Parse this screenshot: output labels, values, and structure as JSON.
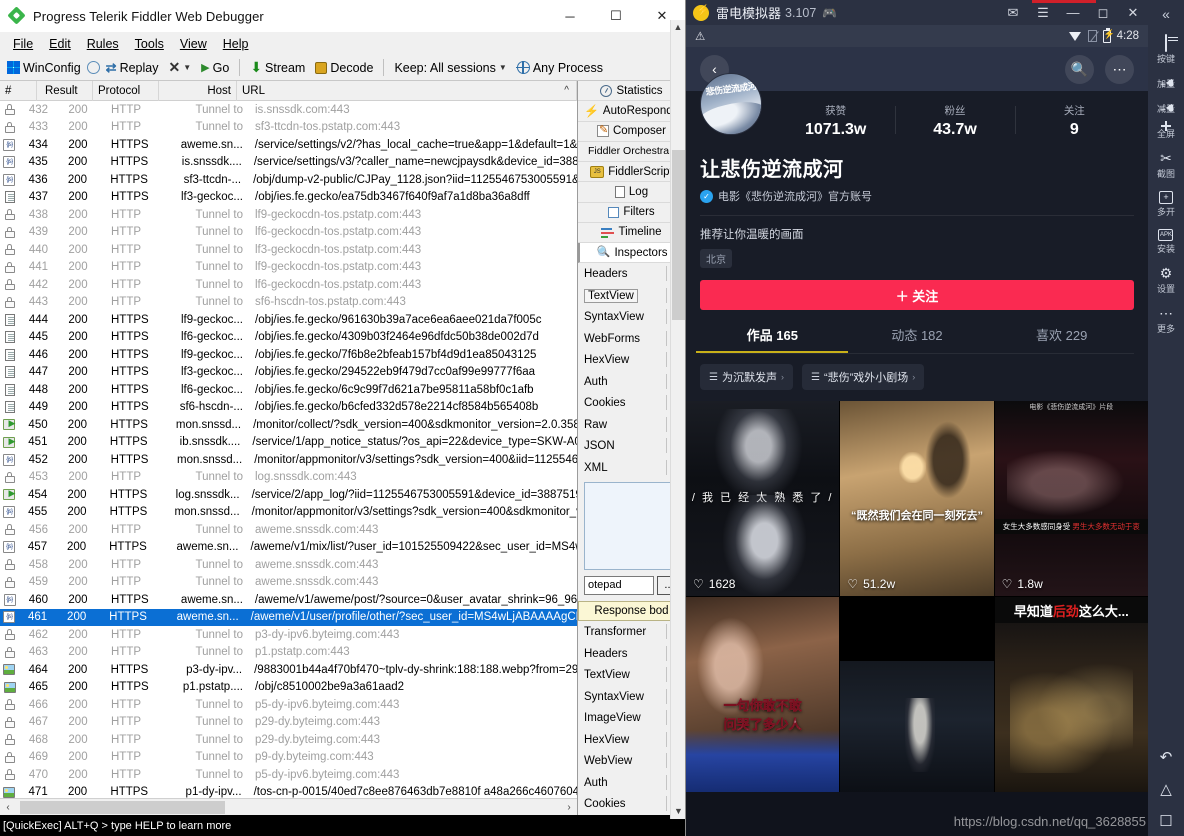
{
  "fiddler": {
    "title": "Progress Telerik Fiddler Web Debugger",
    "window_buttons": {
      "minimize": "─",
      "maximize": "☐",
      "close": "✕"
    },
    "menu": [
      "File",
      "Edit",
      "Rules",
      "Tools",
      "View",
      "Help"
    ],
    "toolbar": {
      "winconfig": "WinConfig",
      "replay": "Replay",
      "remove": "✕",
      "go": "Go",
      "stream": "Stream",
      "decode": "Decode",
      "keep": "Keep: All sessions",
      "process": "Any Process"
    },
    "columns": [
      "#",
      "Result",
      "Protocol",
      "Host",
      "URL"
    ],
    "sessions": [
      {
        "icon": "lock-icon",
        "num": "432",
        "result": "200",
        "protocol": "HTTP",
        "host": "Tunnel to",
        "url": "is.snssdk.com:443",
        "dim": true
      },
      {
        "icon": "lock-icon",
        "num": "433",
        "result": "200",
        "protocol": "HTTP",
        "host": "Tunnel to",
        "url": "sf3-ttcdn-tos.pstatp.com:443",
        "dim": true
      },
      {
        "icon": "json-icon",
        "num": "434",
        "result": "200",
        "protocol": "HTTPS",
        "host": "aweme.sn...",
        "url": "/service/settings/v2/?has_local_cache=true&app=1&default=1&",
        "dim": false
      },
      {
        "icon": "json-icon",
        "num": "435",
        "result": "200",
        "protocol": "HTTPS",
        "host": "is.snssdk....",
        "url": "/service/settings/v3/?caller_name=newcjpaysdk&device_id=388",
        "dim": false
      },
      {
        "icon": "json-icon",
        "num": "436",
        "result": "200",
        "protocol": "HTTPS",
        "host": "sf3-ttcdn-...",
        "url": "/obj/dump-v2-public/CJPay_1128.json?iid=1125546753005591&",
        "dim": false
      },
      {
        "icon": "doc-icon",
        "num": "437",
        "result": "200",
        "protocol": "HTTPS",
        "host": "lf3-geckoc...",
        "url": "/obj/ies.fe.gecko/ea75db3467f640f9af7a1d8ba36a8dff",
        "dim": false
      },
      {
        "icon": "lock-icon",
        "num": "438",
        "result": "200",
        "protocol": "HTTP",
        "host": "Tunnel to",
        "url": "lf9-geckocdn-tos.pstatp.com:443",
        "dim": true
      },
      {
        "icon": "lock-icon",
        "num": "439",
        "result": "200",
        "protocol": "HTTP",
        "host": "Tunnel to",
        "url": "lf6-geckocdn-tos.pstatp.com:443",
        "dim": true
      },
      {
        "icon": "lock-icon",
        "num": "440",
        "result": "200",
        "protocol": "HTTP",
        "host": "Tunnel to",
        "url": "lf3-geckocdn-tos.pstatp.com:443",
        "dim": true
      },
      {
        "icon": "lock-icon",
        "num": "441",
        "result": "200",
        "protocol": "HTTP",
        "host": "Tunnel to",
        "url": "lf9-geckocdn-tos.pstatp.com:443",
        "dim": true
      },
      {
        "icon": "lock-icon",
        "num": "442",
        "result": "200",
        "protocol": "HTTP",
        "host": "Tunnel to",
        "url": "lf6-geckocdn-tos.pstatp.com:443",
        "dim": true
      },
      {
        "icon": "lock-icon",
        "num": "443",
        "result": "200",
        "protocol": "HTTP",
        "host": "Tunnel to",
        "url": "sf6-hscdn-tos.pstatp.com:443",
        "dim": true
      },
      {
        "icon": "doc-icon",
        "num": "444",
        "result": "200",
        "protocol": "HTTPS",
        "host": "lf9-geckoc...",
        "url": "/obj/ies.fe.gecko/961630b39a7ace6ea6aee021da7f005c",
        "dim": false
      },
      {
        "icon": "doc-icon",
        "num": "445",
        "result": "200",
        "protocol": "HTTPS",
        "host": "lf6-geckoc...",
        "url": "/obj/ies.fe.gecko/4309b03f2464e96dfdc50b38de002d7d",
        "dim": false
      },
      {
        "icon": "doc-icon",
        "num": "446",
        "result": "200",
        "protocol": "HTTPS",
        "host": "lf9-geckoc...",
        "url": "/obj/ies.fe.gecko/7f6b8e2bfeab157bf4d9d1ea85043125",
        "dim": false
      },
      {
        "icon": "doc-icon",
        "num": "447",
        "result": "200",
        "protocol": "HTTPS",
        "host": "lf3-geckoc...",
        "url": "/obj/ies.fe.gecko/294522eb9f479d7cc0af99e99777f6aa",
        "dim": false
      },
      {
        "icon": "doc-icon",
        "num": "448",
        "result": "200",
        "protocol": "HTTPS",
        "host": "lf6-geckoc...",
        "url": "/obj/ies.fe.gecko/6c9c99f7d621a7be95811a58bf0c1afb",
        "dim": false
      },
      {
        "icon": "doc-icon",
        "num": "449",
        "result": "200",
        "protocol": "HTTPS",
        "host": "sf6-hscdn-...",
        "url": "/obj/ies.fe.gecko/b6cfed332d578e2214cf8584b565408b",
        "dim": false
      },
      {
        "icon": "arrow-icon",
        "num": "450",
        "result": "200",
        "protocol": "HTTPS",
        "host": "mon.snssd...",
        "url": "/monitor/collect/?sdk_version=400&sdkmonitor_version=2.0.358",
        "dim": false
      },
      {
        "icon": "arrow-icon",
        "num": "451",
        "result": "200",
        "protocol": "HTTPS",
        "host": "ib.snssdk....",
        "url": "/service/1/app_notice_status/?os_api=22&device_type=SKW-A0",
        "dim": false
      },
      {
        "icon": "json-icon",
        "num": "452",
        "result": "200",
        "protocol": "HTTPS",
        "host": "mon.snssd...",
        "url": "/monitor/appmonitor/v3/settings?sdk_version=400&iid=1125546",
        "dim": false
      },
      {
        "icon": "lock-icon",
        "num": "453",
        "result": "200",
        "protocol": "HTTP",
        "host": "Tunnel to",
        "url": "log.snssdk.com:443",
        "dim": true
      },
      {
        "icon": "arrow-icon",
        "num": "454",
        "result": "200",
        "protocol": "HTTPS",
        "host": "log.snssdk...",
        "url": "/service/2/app_log/?iid=1125546753005591&device_id=3887519",
        "dim": false
      },
      {
        "icon": "json-icon",
        "num": "455",
        "result": "200",
        "protocol": "HTTPS",
        "host": "mon.snssd...",
        "url": "/monitor/appmonitor/v3/settings?sdk_version=400&sdkmonitor_v",
        "dim": false
      },
      {
        "icon": "lock-icon",
        "num": "456",
        "result": "200",
        "protocol": "HTTP",
        "host": "Tunnel to",
        "url": "aweme.snssdk.com:443",
        "dim": true
      },
      {
        "icon": "json-icon",
        "num": "457",
        "result": "200",
        "protocol": "HTTPS",
        "host": "aweme.sn...",
        "url": "/aweme/v1/mix/list/?user_id=101525509422&sec_user_id=MS4w",
        "dim": false
      },
      {
        "icon": "lock-icon",
        "num": "458",
        "result": "200",
        "protocol": "HTTP",
        "host": "Tunnel to",
        "url": "aweme.snssdk.com:443",
        "dim": true
      },
      {
        "icon": "lock-icon",
        "num": "459",
        "result": "200",
        "protocol": "HTTP",
        "host": "Tunnel to",
        "url": "aweme.snssdk.com:443",
        "dim": true
      },
      {
        "icon": "json-icon",
        "num": "460",
        "result": "200",
        "protocol": "HTTPS",
        "host": "aweme.sn...",
        "url": "/aweme/v1/aweme/post/?source=0&user_avatar_shrink=96_96",
        "dim": false
      },
      {
        "icon": "json-icon",
        "num": "461",
        "result": "200",
        "protocol": "HTTPS",
        "host": "aweme.sn...",
        "url": "/aweme/v1/user/profile/other/?sec_user_id=MS4wLjABAAAAgCE",
        "dim": false,
        "selected": true
      },
      {
        "icon": "lock-icon",
        "num": "462",
        "result": "200",
        "protocol": "HTTP",
        "host": "Tunnel to",
        "url": "p3-dy-ipv6.byteimg.com:443",
        "dim": true
      },
      {
        "icon": "lock-icon",
        "num": "463",
        "result": "200",
        "protocol": "HTTP",
        "host": "Tunnel to",
        "url": "p1.pstatp.com:443",
        "dim": true
      },
      {
        "icon": "image-icon",
        "num": "464",
        "result": "200",
        "protocol": "HTTPS",
        "host": "p3-dy-ipv...",
        "url": "/9883001b44a4f70bf470~tplv-dy-shrink:188:188.webp?from=29",
        "dim": false
      },
      {
        "icon": "image-icon",
        "num": "465",
        "result": "200",
        "protocol": "HTTPS",
        "host": "p1.pstatp....",
        "url": "/obj/c8510002be9a3a61aad2",
        "dim": false
      },
      {
        "icon": "lock-icon",
        "num": "466",
        "result": "200",
        "protocol": "HTTP",
        "host": "Tunnel to",
        "url": "p5-dy-ipv6.byteimg.com:443",
        "dim": true
      },
      {
        "icon": "lock-icon",
        "num": "467",
        "result": "200",
        "protocol": "HTTP",
        "host": "Tunnel to",
        "url": "p29-dy.byteimg.com:443",
        "dim": true
      },
      {
        "icon": "lock-icon",
        "num": "468",
        "result": "200",
        "protocol": "HTTP",
        "host": "Tunnel to",
        "url": "p29-dy.byteimg.com:443",
        "dim": true
      },
      {
        "icon": "lock-icon",
        "num": "469",
        "result": "200",
        "protocol": "HTTP",
        "host": "Tunnel to",
        "url": "p9-dy.byteimg.com:443",
        "dim": true
      },
      {
        "icon": "lock-icon",
        "num": "470",
        "result": "200",
        "protocol": "HTTP",
        "host": "Tunnel to",
        "url": "p5-dy-ipv6.byteimg.com:443",
        "dim": true
      },
      {
        "icon": "image-icon",
        "num": "471",
        "result": "200",
        "protocol": "HTTPS",
        "host": "p1-dy-ipv...",
        "url": "/tos-cn-p-0015/40ed7c8ee876463db7e8810f a48a266c4607604",
        "dim": false
      }
    ],
    "inspector": {
      "top_tabs": [
        {
          "label": "Statistics",
          "icon": "statistics-icon"
        },
        {
          "label": "AutoResponde",
          "icon": "bolt-icon"
        },
        {
          "label": "Composer",
          "icon": "pencil-icon"
        }
      ],
      "orchestra": "Fiddler Orchestra I",
      "tabs2": [
        {
          "label": "FiddlerScript",
          "icon": "fiddlerscript-icon"
        },
        {
          "label": "Log",
          "icon": "log-icon"
        },
        {
          "label": "Filters",
          "icon": "filters-icon"
        },
        {
          "label": "Timeline",
          "icon": "timeline-icon"
        },
        {
          "label": "Inspectors",
          "icon": "inspectors-icon",
          "selected": true
        }
      ],
      "request_views": [
        "Headers",
        "TextView",
        "SyntaxView",
        "WebForms",
        "HexView",
        "Auth",
        "Cookies",
        "Raw",
        "JSON",
        "XML"
      ],
      "request_view_active": "TextView",
      "notepad_field": "otepad",
      "browse_button": "...",
      "response_label": "Response bod",
      "response_views": [
        "Transformer",
        "Headers",
        "TextView",
        "SyntaxView",
        "ImageView",
        "HexView",
        "WebView",
        "Auth",
        "Cookies"
      ]
    },
    "statusbar": "[QuickExec] ALT+Q > type HELP to learn more"
  },
  "emulator": {
    "title": "雷电模拟器",
    "version": "3.107",
    "titlebar_icons": [
      "mail-icon",
      "menu-icon",
      "minimize-icon",
      "maximize-icon",
      "close-icon"
    ],
    "android_status": {
      "time": "4:28",
      "icons": [
        "warning-icon",
        "wifi-icon",
        "sim-off-icon",
        "battery-icon"
      ]
    },
    "app_header": {
      "back": "‹",
      "search": "search-icon",
      "more": "⋯"
    },
    "profile": {
      "avatar_text": "悲伤逆流成河",
      "stats": [
        {
          "label": "获赞",
          "value": "1071.3w"
        },
        {
          "label": "粉丝",
          "value": "43.7w"
        },
        {
          "label": "关注",
          "value": "9"
        }
      ],
      "nickname": "让悲伤逆流成河",
      "verified_text": "电影《悲伤逆流成河》官方账号",
      "bio": "推荐让你温暖的画面",
      "location_tag": "北京",
      "follow_button": "＋ 关注",
      "tabs": [
        {
          "label": "作品 165",
          "selected": true
        },
        {
          "label": "动态 182",
          "selected": false
        },
        {
          "label": "喜欢 229",
          "selected": false
        }
      ],
      "chips": [
        {
          "label": "为沉默发声",
          "arrow": "›"
        },
        {
          "label": "“悲伤”戏外小剧场",
          "arrow": "›"
        }
      ]
    },
    "videos": [
      {
        "likes": "1628",
        "caption": "/ 我 已 经 太 熟 悉 了 /"
      },
      {
        "likes": "51.2w",
        "caption": "“既然我们会在同一刻死去”"
      },
      {
        "likes": "1.8w",
        "caption": "电影《悲伤逆流成河》片段",
        "bar_left": "女生大多数感同身受",
        "bar_right": "男生大多数无动于衷"
      },
      {
        "likes": "",
        "caption": "一句你敢不敢\n问哭了多少人"
      },
      {
        "likes": "",
        "caption": ""
      },
      {
        "likes": "",
        "caption": "早知道",
        "caption_red": "后劲",
        "caption_tail": "这么大..."
      }
    ],
    "watermark": "https://blog.csdn.net/qq_3628855",
    "side_toolbar": [
      {
        "label": "按键",
        "icon": "keyboard-icon"
      },
      {
        "label": "加量",
        "icon": "volume-up-icon"
      },
      {
        "label": "减量",
        "icon": "volume-down-icon"
      },
      {
        "label": "全屏",
        "icon": "fullscreen-icon"
      },
      {
        "label": "截图",
        "icon": "scissors-icon"
      },
      {
        "label": "多开",
        "icon": "multi-instance-icon"
      },
      {
        "label": "安装",
        "icon": "apk-install-icon"
      },
      {
        "label": "设置",
        "icon": "gear-icon"
      },
      {
        "label": "更多",
        "icon": "more-dots-icon"
      }
    ],
    "nav_buttons": [
      "back-icon",
      "home-icon",
      "recents-icon"
    ],
    "collapse": "«"
  }
}
